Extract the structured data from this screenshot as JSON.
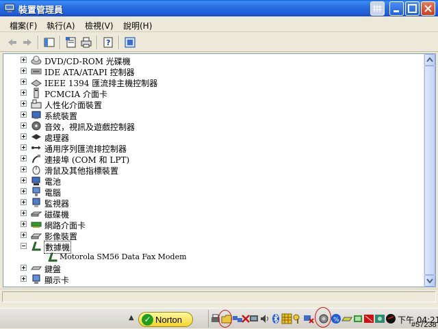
{
  "window": {
    "title": "裝置管理員"
  },
  "menu": {
    "items": [
      {
        "label": "檔案(F)"
      },
      {
        "label": "執行(A)"
      },
      {
        "label": "檢視(V)"
      },
      {
        "label": "說明(H)"
      }
    ]
  },
  "tree": {
    "items": [
      {
        "label": "DVD/CD-ROM 光碟機",
        "expander": "plus",
        "icon": "cdrom-icon"
      },
      {
        "label": "IDE ATA/ATAPI 控制器",
        "expander": "plus",
        "icon": "ide-controller-icon"
      },
      {
        "label": "IEEE 1394 匯流排主機控制器",
        "expander": "plus",
        "icon": "ieee1394-icon"
      },
      {
        "label": "PCMCIA 介面卡",
        "expander": "plus",
        "icon": "pcmcia-icon"
      },
      {
        "label": "人性化介面裝置",
        "expander": "plus",
        "icon": "hid-icon"
      },
      {
        "label": "系統裝置",
        "expander": "plus",
        "icon": "system-device-icon"
      },
      {
        "label": "音效，視訊及遊戲控制器",
        "expander": "plus",
        "icon": "sound-icon"
      },
      {
        "label": "處理器",
        "expander": "plus",
        "icon": "processor-icon"
      },
      {
        "label": "通用序列匯流排控制器",
        "expander": "plus",
        "icon": "usb-icon"
      },
      {
        "label": "連接埠 (COM 和 LPT)",
        "expander": "plus",
        "icon": "port-icon"
      },
      {
        "label": "滑鼠及其他指標裝置",
        "expander": "plus",
        "icon": "mouse-icon"
      },
      {
        "label": "電池",
        "expander": "plus",
        "icon": "battery-icon"
      },
      {
        "label": "電腦",
        "expander": "plus",
        "icon": "computer-icon"
      },
      {
        "label": "監視器",
        "expander": "plus",
        "icon": "monitor-icon"
      },
      {
        "label": "磁碟機",
        "expander": "plus",
        "icon": "disk-drive-icon"
      },
      {
        "label": "網路介面卡",
        "expander": "plus",
        "icon": "network-adapter-icon"
      },
      {
        "label": "影像裝置",
        "expander": "plus",
        "icon": "imaging-device-icon"
      },
      {
        "label": "數據機",
        "expander": "minus",
        "icon": "modem-icon",
        "selected": true
      },
      {
        "label": "鍵盤",
        "expander": "plus",
        "icon": "keyboard-icon"
      },
      {
        "label": "顯示卡",
        "expander": "plus",
        "icon": "display-adapter-icon"
      }
    ],
    "child": {
      "label": "Motorola SM56 Data Fax Modem",
      "icon": "modem-device-icon"
    }
  },
  "taskbar": {
    "norton_label": "Norton",
    "clock": "下午 04:21",
    "watermark": "#57238"
  },
  "colors": {
    "titlebar": "#2a6fe0",
    "window_bg": "#ece9d8",
    "annotation": "#d01010"
  }
}
